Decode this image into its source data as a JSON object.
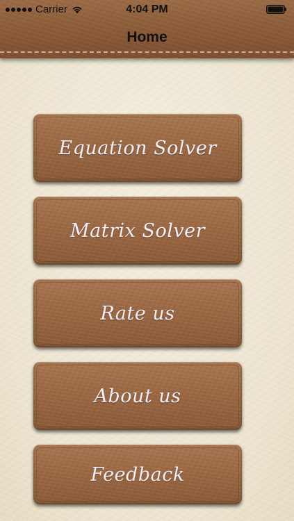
{
  "status_bar": {
    "carrier": "Carrier",
    "time": "4:04 PM",
    "signal_icon": "signal-dots-icon",
    "wifi_icon": "wifi-icon",
    "battery_icon": "battery-icon"
  },
  "navbar": {
    "title": "Home"
  },
  "menu": {
    "items": [
      {
        "label": "Equation Solver"
      },
      {
        "label": "Matrix Solver"
      },
      {
        "label": "Rate us"
      },
      {
        "label": "About us"
      },
      {
        "label": "Feedback"
      }
    ]
  },
  "colors": {
    "background": "#efe8d6",
    "header_leather": "#8a5a38",
    "button_leather": "#9a6843",
    "button_text": "#f4eef6"
  }
}
